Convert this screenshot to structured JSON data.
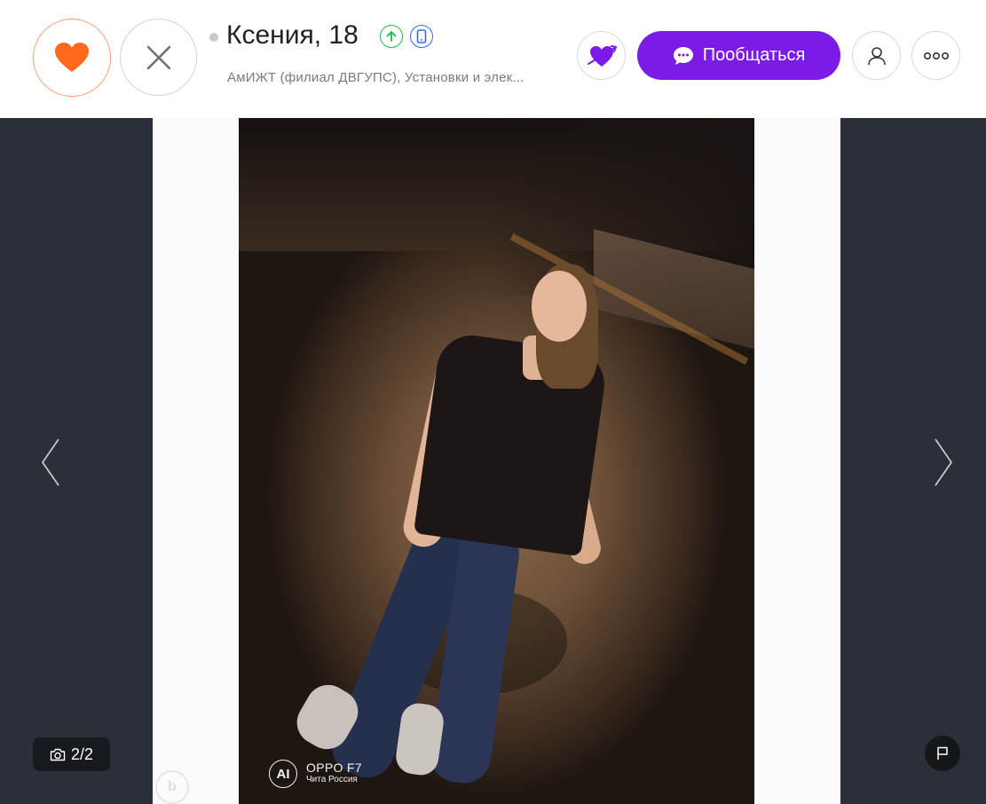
{
  "profile": {
    "name_age": "Ксения, 18",
    "subtitle": "АмИЖТ (филиал ДВГУПС), Установки и элек...",
    "online_status": "offline"
  },
  "actions": {
    "chat_label": "Пообщаться"
  },
  "gallery": {
    "counter": "2/2",
    "watermark_model": "OPPO F7",
    "watermark_location": "Чита Россия",
    "watermark_ai": "AI"
  },
  "colors": {
    "like_orange": "#ff6a1f",
    "accent_purple": "#7b1be8",
    "verified_green": "#20b84a",
    "phone_blue": "#2f6ee8",
    "gallery_bg": "#2b3038"
  },
  "icons": {
    "like": "heart-icon",
    "skip": "close-icon",
    "badge_up": "arrow-up-icon",
    "badge_phone": "phone-icon",
    "heart_arrow": "heart-arrow-icon",
    "chat": "chat-bubble-icon",
    "profile": "user-icon",
    "more": "more-dots-icon",
    "prev": "chevron-left-icon",
    "next": "chevron-right-icon",
    "camera": "camera-icon",
    "report": "flag-icon"
  }
}
